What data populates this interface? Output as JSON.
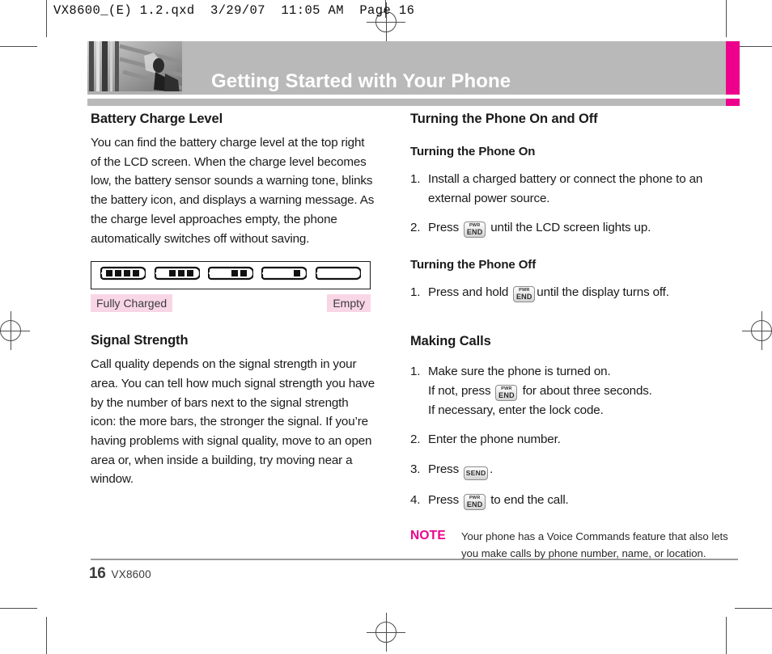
{
  "prepress": {
    "slug": "VX8600_(E) 1.2.qxd  3/29/07  11:05 AM  Page 16"
  },
  "header": {
    "title": "Getting Started with Your Phone",
    "accent_color": "#ec008c",
    "band_color": "#b9b9b9",
    "photo_alt": "abstract-grayscale-photo"
  },
  "left_column": {
    "battery_section": {
      "heading": "Battery Charge Level",
      "body": "You can find the battery charge level at the top right of the LCD screen. When the charge level becomes low, the battery sensor sounds a warning tone, blinks the battery icon, and displays a warning message. As the charge level approaches empty, the phone automatically switches off without saving.",
      "figure": {
        "icons": [
          {
            "name": "battery-4-bars",
            "bars": 4
          },
          {
            "name": "battery-3-bars",
            "bars": 3
          },
          {
            "name": "battery-2-bars",
            "bars": 2
          },
          {
            "name": "battery-1-bar",
            "bars": 1
          },
          {
            "name": "battery-0-bars",
            "bars": 0
          }
        ],
        "label_full": "Fully Charged",
        "label_empty": "Empty",
        "label_highlight_color": "#f9d6e6"
      }
    },
    "signal_section": {
      "heading": "Signal Strength",
      "body": "Call quality depends on the signal strength in your area. You can tell how much signal strength you have by the number of bars next to the signal strength icon: the more bars, the stronger the signal. If you’re having problems with signal quality, move to an open area or, when inside a building, try moving near a window."
    }
  },
  "right_column": {
    "power_section": {
      "heading": "Turning the Phone On and Off",
      "on_subheading": "Turning the Phone On",
      "on_steps": [
        {
          "num": "1.",
          "text_before": "Install a charged battery or connect the phone to an external power source.",
          "key": null,
          "text_after": ""
        },
        {
          "num": "2.",
          "text_before": "Press",
          "key": "pwr-end",
          "text_after": "until the LCD screen lights up."
        }
      ],
      "off_subheading": "Turning the Phone Off",
      "off_steps": [
        {
          "num": "1.",
          "text_before": "Press and hold",
          "key": "pwr-end",
          "text_after": "until the display turns off."
        }
      ]
    },
    "calls_section": {
      "heading": "Making Calls",
      "steps": [
        {
          "num": "1.",
          "line1": "Make sure the phone is turned on.",
          "line2_before": "If not, press",
          "key": "pwr-end",
          "line2_after": "for about three seconds.",
          "line3": "If necessary, enter the lock code."
        },
        {
          "num": "2.",
          "line1": "Enter the phone number.",
          "line2_before": "",
          "key": null,
          "line2_after": "",
          "line3": ""
        },
        {
          "num": "3.",
          "line1": "",
          "line2_before": "Press",
          "key": "send",
          "line2_after": ".",
          "line3": ""
        },
        {
          "num": "4.",
          "line1": "",
          "line2_before": "Press",
          "key": "pwr-end",
          "line2_after": "to end the call.",
          "line3": ""
        }
      ]
    },
    "note": {
      "label": "NOTE",
      "label_color": "#ec008c",
      "text": "Your phone has a Voice Commands feature that also lets you make calls by phone number, name, or location."
    }
  },
  "keys": {
    "pwr_end": {
      "top": "PWR",
      "bottom": "END"
    },
    "send": {
      "label": "SEND"
    }
  },
  "footer": {
    "page_number": "16",
    "model": "VX8600"
  }
}
